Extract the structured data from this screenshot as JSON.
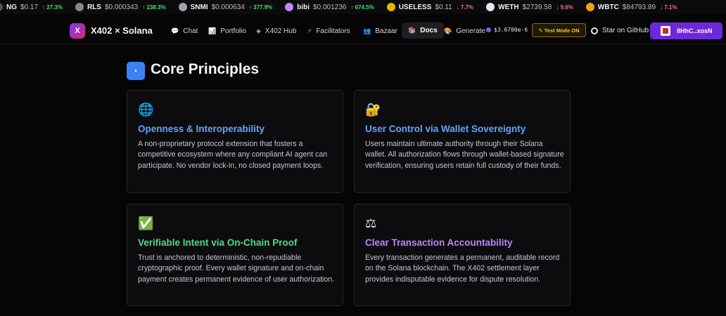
{
  "ticker": [
    {
      "symbol": "NG",
      "price": "$0.17",
      "change": "27.3%",
      "dir": "up",
      "icon": "token-icon",
      "color": "#555"
    },
    {
      "symbol": "RLS",
      "price": "$0.000343",
      "change": "238.3%",
      "dir": "up",
      "icon": "token-icon",
      "color": "#888"
    },
    {
      "symbol": "SNMI",
      "price": "$0.000634",
      "change": "377.9%",
      "dir": "up",
      "icon": "token-icon",
      "color": "#9ca3af"
    },
    {
      "symbol": "bibi",
      "price": "$0.001236",
      "change": "674.5%",
      "dir": "up",
      "icon": "token-icon",
      "color": "#c084fc"
    },
    {
      "symbol": "USELESS",
      "price": "$0.11",
      "change": "7.7%",
      "dir": "down",
      "icon": "token-icon",
      "color": "#eab308"
    },
    {
      "symbol": "WETH",
      "price": "$2739.58",
      "change": "9.6%",
      "dir": "down",
      "icon": "token-icon",
      "color": "#e5e7eb"
    },
    {
      "symbol": "WBTC",
      "price": "$84793.89",
      "change": "7.1%",
      "dir": "down",
      "icon": "token-icon",
      "color": "#f59e0b"
    }
  ],
  "nav": {
    "logo_badge": "X",
    "logo_text": "X402 × Solana",
    "items": [
      {
        "label": "Chat",
        "icon": "chat-icon",
        "glyph": "💬"
      },
      {
        "label": "Portfolio",
        "icon": "portfolio-icon",
        "glyph": "📊"
      },
      {
        "label": "X402 Hub",
        "icon": "hub-icon",
        "glyph": "◈"
      },
      {
        "label": "Facilitators",
        "icon": "bolt-icon",
        "glyph": "⚡"
      },
      {
        "label": "Bazaar",
        "icon": "bazaar-icon",
        "glyph": "👥"
      },
      {
        "label": "Docs",
        "icon": "docs-icon",
        "glyph": "📚"
      },
      {
        "label": "Generate",
        "icon": "generate-icon",
        "glyph": "🎨"
      }
    ],
    "price": "$3.6700e-6",
    "test_mode": "✎ Test Mode ON",
    "github": "Star on GitHub",
    "wallet": "8HhC..xosN"
  },
  "section": {
    "icon_glyph": "•",
    "title": "Core Principles"
  },
  "cards": [
    {
      "icon": "globe-icon",
      "glyph": "🌐",
      "title": "Openness & Interoperability",
      "title_color": "#60a5fa",
      "text": "A non-proprietary protocol extension that fosters a competitive ecosystem where any compliant AI agent can participate. No vendor lock-in, no closed payment loops."
    },
    {
      "icon": "lock-icon",
      "glyph": "🔐",
      "title": "User Control via Wallet Sovereignty",
      "title_color": "#60a5fa",
      "text": "Users maintain ultimate authority through their Solana wallet. All authorization flows through wallet-based signature verification, ensuring users retain full custody of their funds."
    },
    {
      "icon": "checkmark-icon",
      "glyph": "✅",
      "title": "Verifiable Intent via On-Chain Proof",
      "title_color": "#4ade80",
      "text": "Trust is anchored to deterministic, non-repudiable cryptographic proof. Every wallet signature and on-chain payment creates permanent evidence of user authorization."
    },
    {
      "icon": "scales-icon",
      "glyph": "⚖",
      "title": "Clear Transaction Accountability",
      "title_color": "#c084fc",
      "text": "Every transaction generates a permanent, auditable record on the Solana blockchain. The X402 settlement layer provides indisputable evidence for dispute resolution."
    }
  ]
}
